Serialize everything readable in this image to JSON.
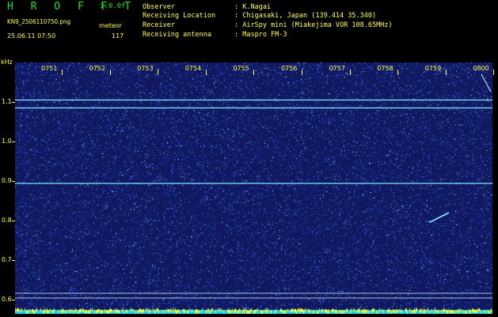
{
  "header": {
    "app_title": "H R O F F T",
    "version": "1.0.0f",
    "file_name": "KN9_2506110750.png",
    "timestamp": "25.06.11 07:50",
    "meteor_label": "meteor",
    "meteor_count": "117",
    "info": [
      {
        "key": "Observer",
        "value": ": K.Nagai"
      },
      {
        "key": "Receiving Location",
        "value": ": Chigasaki, Japan (139.414 35.340)"
      },
      {
        "key": "Receiver",
        "value": ": AirSpy mini (Miakejima VOR 108.65MHz)"
      },
      {
        "key": "Receiving antenna",
        "value": ": Maspro FM-3"
      }
    ]
  },
  "spectrogram": {
    "y_unit": "kHz",
    "y_ticks": [
      "1.1",
      "1.0",
      "0.9",
      "0.8",
      "0.7",
      "0.6"
    ],
    "x_ticks": [
      "0751",
      "0752",
      "0753",
      "0754",
      "0755",
      "0756",
      "0757",
      "0758",
      "0759",
      "0800"
    ],
    "background_color": "#101860",
    "noise_color": "#3a78ff",
    "trace_color": "#7fe8ff",
    "label_color": "#ffff40",
    "persistent_carriers_khz": [
      1.105,
      1.085,
      0.894,
      0.616,
      0.604
    ],
    "meteor_echo": {
      "start_time": "07:58:45",
      "end_time": "07:59:10",
      "start_khz": 0.795,
      "end_khz": 0.82
    }
  }
}
